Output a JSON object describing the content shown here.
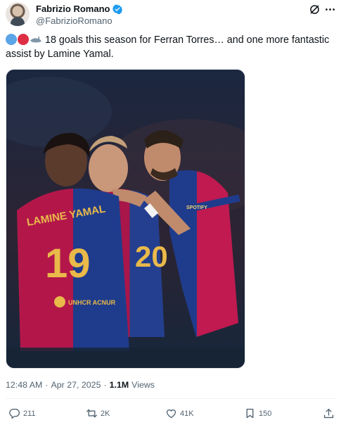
{
  "author": {
    "display_name": "Fabrizio Romano",
    "handle": "@FabrizioRomano",
    "verified_color": "#1d9bf0"
  },
  "post": {
    "emojis": [
      "blue-circle",
      "red-circle",
      "shark"
    ],
    "text": "18 goals this season for Ferran Torres… and one more fantastic assist by Lamine Yamal.",
    "image": {
      "jersey_left_name": "LAMINE YAMAL",
      "jersey_left_number": "19",
      "jersey_middle_number": "20",
      "sponsor": "UNHCR ACNUR",
      "sleeve_text": "SPOTIFY"
    },
    "time": "12:48 AM",
    "date": "Apr 27, 2025",
    "separator": "·",
    "views_count": "1.1M",
    "views_label": "Views"
  },
  "actions": {
    "replies": "211",
    "reposts": "2K",
    "likes": "41K",
    "bookmarks": "150"
  },
  "colors": {
    "text": "#0f1419",
    "muted": "#536471",
    "jersey_blue": "#1f3c8c",
    "jersey_red": "#b3174a",
    "jersey_gold": "#e9b94a"
  }
}
